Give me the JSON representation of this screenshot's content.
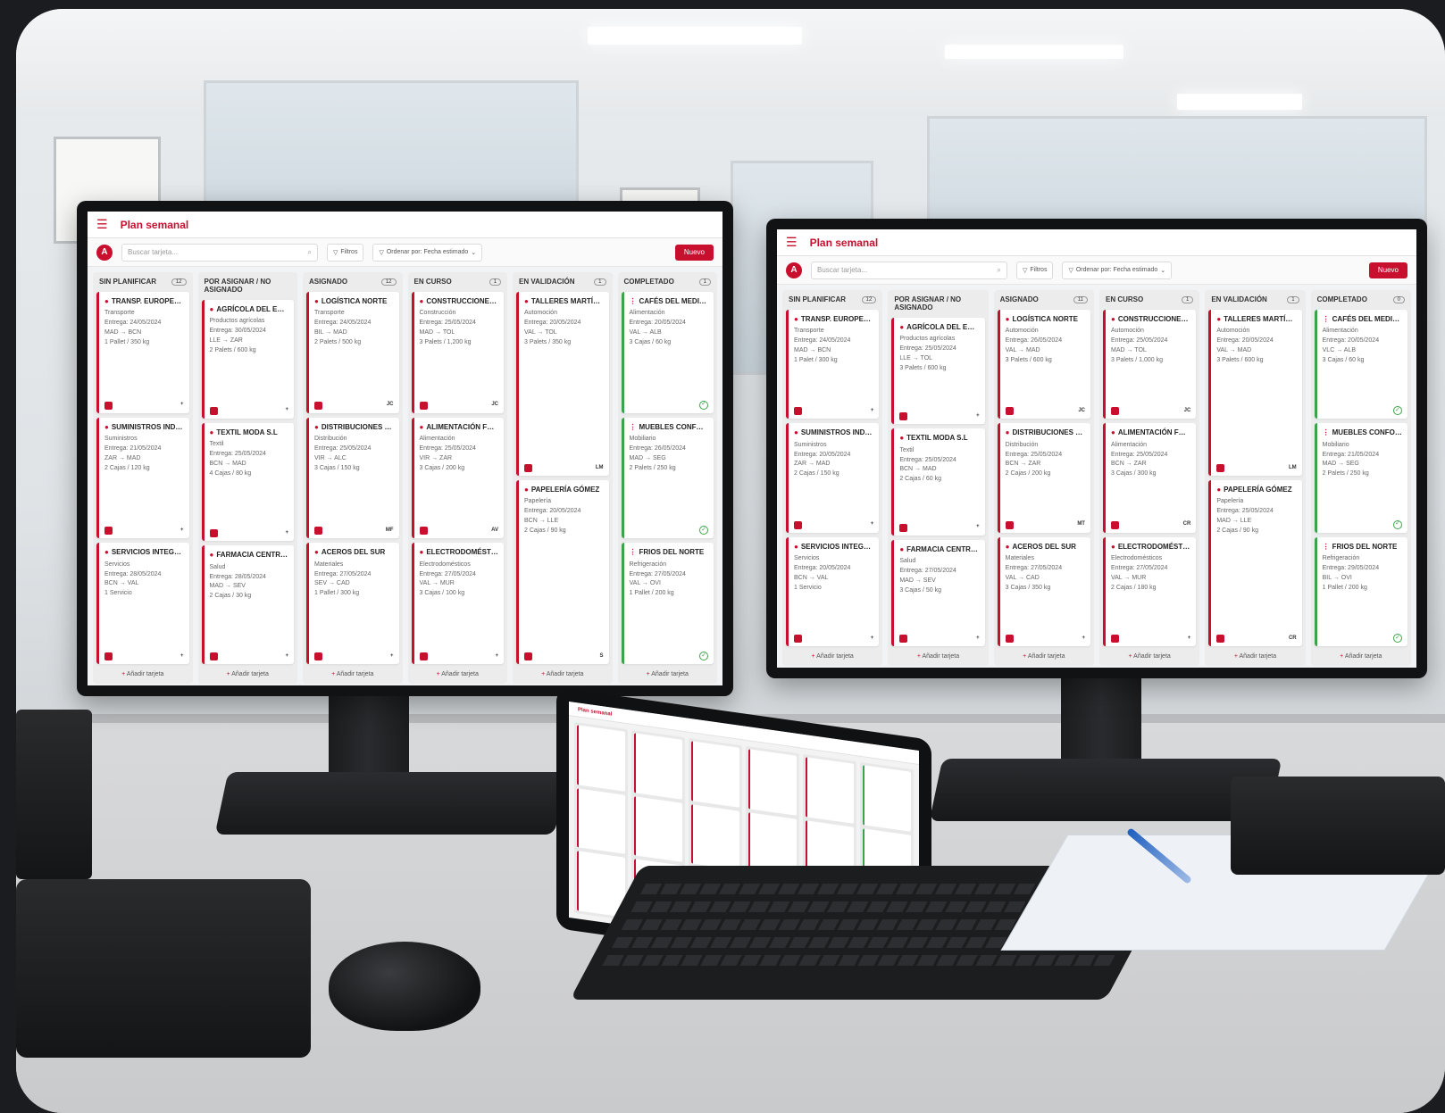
{
  "app": {
    "title": "Plan semanal",
    "logo_letter": "A",
    "search_placeholder": "Buscar tarjeta...",
    "filters_label": "Filtros",
    "sort_label": "Ordenar por: Fecha estimado",
    "new_button": "Nuevo",
    "add_card": "Añadir tarjeta"
  },
  "accent_color": "#c8102e",
  "done_color": "#3da34a",
  "left_board": {
    "columns": [
      {
        "title": "SIN PLANIFICAR",
        "count": "12",
        "cards": [
          {
            "name": "TRANSP. EUROPEO S.L.",
            "cat": "Transporte",
            "date": "Entrega: 24/05/2024",
            "route": "MAD → BCN",
            "load": "1 Pallet / 350 kg",
            "ini": ""
          },
          {
            "name": "SUMINISTROS INDUSTRIALES",
            "cat": "Suministros",
            "date": "Entrega: 21/05/2024",
            "route": "ZAR → MAD",
            "load": "2 Cajas / 120 kg",
            "ini": ""
          },
          {
            "name": "SERVICIOS INTEGRALES",
            "cat": "Servicios",
            "date": "Entrega: 28/05/2024",
            "route": "BCN → VAL",
            "load": "1 Servicio",
            "ini": ""
          }
        ]
      },
      {
        "title": "POR ASIGNAR / NO ASIGNADO",
        "count": "",
        "cards": [
          {
            "name": "AGRÍCOLA DEL EBRO",
            "cat": "Productos agrícolas",
            "date": "Entrega: 30/05/2024",
            "route": "LLE → ZAR",
            "load": "2 Palets / 600 kg",
            "ini": ""
          },
          {
            "name": "TEXTIL MODA S.L",
            "cat": "Textil",
            "date": "Entrega: 25/05/2024",
            "route": "BCN → MAD",
            "load": "4 Cajas / 80 kg",
            "ini": ""
          },
          {
            "name": "FARMACIA CENTRAL",
            "cat": "Salud",
            "date": "Entrega: 28/05/2024",
            "route": "MAD → SEV",
            "load": "2 Cajas / 30 kg",
            "ini": ""
          }
        ]
      },
      {
        "title": "ASIGNADO",
        "count": "12",
        "cards": [
          {
            "name": "LOGÍSTICA NORTE",
            "cat": "Transporte",
            "date": "Entrega: 24/05/2024",
            "route": "BIL → MAD",
            "load": "2 Palets / 500 kg",
            "ini": "JC"
          },
          {
            "name": "DISTRIBUCIONES LEVANTE",
            "cat": "Distribución",
            "date": "Entrega: 25/05/2024",
            "route": "VIR → ALC",
            "load": "3 Cajas / 150 kg",
            "ini": "MF"
          },
          {
            "name": "ACEROS DEL SUR",
            "cat": "Materiales",
            "date": "Entrega: 27/05/2024",
            "route": "SEV → CAD",
            "load": "1 Pallet / 300 kg",
            "ini": ""
          }
        ]
      },
      {
        "title": "EN CURSO",
        "count": "1",
        "cards": [
          {
            "name": "CONSTRUCCIONES & CÍA",
            "cat": "Construcción",
            "date": "Entrega: 25/05/2024",
            "route": "MAD → TOL",
            "load": "3 Palets / 1,200 kg",
            "ini": "JC"
          },
          {
            "name": "ALIMENTACIÓN FRESCA",
            "cat": "Alimentación",
            "date": "Entrega: 25/05/2024",
            "route": "VIR → ZAR",
            "load": "3 Cajas / 200 kg",
            "ini": "AV"
          },
          {
            "name": "ELECTRODOMÉSTICOS DELUXE",
            "cat": "Electrodomésticos",
            "date": "Entrega: 27/05/2024",
            "route": "VAL → MUR",
            "load": "3 Cajas / 100 kg",
            "ini": ""
          }
        ]
      },
      {
        "title": "EN VALIDACIÓN",
        "count": "1",
        "cards": [
          {
            "name": "TALLERES MARTÍNEZ",
            "cat": "Automoción",
            "date": "Entrega: 20/05/2024",
            "route": "VAL → TOL",
            "load": "3 Palets / 350 kg",
            "ini": "LM"
          },
          {
            "name": "PAPELERÍA GÓMEZ",
            "cat": "Papelería",
            "date": "Entrega: 20/05/2024",
            "route": "BCN → LLE",
            "load": "2 Cajas / 90 kg",
            "ini": "S"
          }
        ]
      },
      {
        "title": "COMPLETADO",
        "count": "1",
        "done": true,
        "cards": [
          {
            "name": "CAFÉS DEL MEDITERRÁNEO",
            "cat": "Alimentación",
            "date": "Entrega: 20/05/2024",
            "route": "VAL → ALB",
            "load": "3 Cajas / 60 kg",
            "ini": ""
          },
          {
            "name": "MUEBLES CONFORT",
            "cat": "Mobiliario",
            "date": "Entrega: 26/05/2024",
            "route": "MAD → SEG",
            "load": "2 Palets / 250 kg",
            "ini": ""
          },
          {
            "name": "FRIOS DEL NORTE",
            "cat": "Refrigeración",
            "date": "Entrega: 27/05/2024",
            "route": "VAL → OVI",
            "load": "1 Pallet / 200 kg",
            "ini": ""
          }
        ]
      }
    ]
  },
  "right_board": {
    "columns": [
      {
        "title": "SIN PLANIFICAR",
        "count": "12",
        "cards": [
          {
            "name": "TRANSP. EUROPEO S.L.",
            "cat": "Transporte",
            "date": "Entrega: 24/05/2024",
            "route": "MAD → BCN",
            "load": "1 Palet / 300 kg",
            "ini": ""
          },
          {
            "name": "SUMINISTROS INDUSTRIALES",
            "cat": "Suministros",
            "date": "Entrega: 20/05/2024",
            "route": "ZAR → MAD",
            "load": "2 Cajas / 150 kg",
            "ini": ""
          },
          {
            "name": "SERVICIOS INTEGRALES",
            "cat": "Servicios",
            "date": "Entrega: 20/05/2024",
            "route": "BCN → VAL",
            "load": "1 Servicio",
            "ini": ""
          }
        ]
      },
      {
        "title": "POR ASIGNAR / NO ASIGNADO",
        "count": "",
        "cards": [
          {
            "name": "AGRÍCOLA DEL EBRO",
            "cat": "Productos agrícolas",
            "date": "Entrega: 25/05/2024",
            "route": "LLE → TOL",
            "load": "3 Palets / 600 kg",
            "ini": ""
          },
          {
            "name": "TEXTIL MODA S.L",
            "cat": "Textil",
            "date": "Entrega: 25/05/2024",
            "route": "BCN → MAD",
            "load": "2 Cajas / 60 kg",
            "ini": ""
          },
          {
            "name": "FARMACIA CENTRAL",
            "cat": "Salud",
            "date": "Entrega: 27/05/2024",
            "route": "MAD → SEV",
            "load": "3 Cajas / 50 kg",
            "ini": ""
          }
        ]
      },
      {
        "title": "ASIGNADO",
        "count": "11",
        "cards": [
          {
            "name": "LOGÍSTICA NORTE",
            "cat": "Automoción",
            "date": "Entrega: 26/05/2024",
            "route": "VAL → MAD",
            "load": "3 Palets / 600 kg",
            "ini": "JC"
          },
          {
            "name": "DISTRIBUCIONES LEVANTE",
            "cat": "Distribución",
            "date": "Entrega: 25/05/2024",
            "route": "BCN → ZAR",
            "load": "2 Cajas / 200 kg",
            "ini": "MT"
          },
          {
            "name": "ACEROS DEL SUR",
            "cat": "Materiales",
            "date": "Entrega: 27/05/2024",
            "route": "VAL → CAD",
            "load": "3 Cajas / 350 kg",
            "ini": ""
          }
        ]
      },
      {
        "title": "EN CURSO",
        "count": "1",
        "cards": [
          {
            "name": "CONSTRUCCIONES & CÍA",
            "cat": "Automoción",
            "date": "Entrega: 25/05/2024",
            "route": "MAD → TOL",
            "load": "3 Palets / 1,000 kg",
            "ini": "JC"
          },
          {
            "name": "ALIMENTACIÓN FRESCA",
            "cat": "Alimentación",
            "date": "Entrega: 25/05/2024",
            "route": "BCN → ZAR",
            "load": "3 Cajas / 300 kg",
            "ini": "CR"
          },
          {
            "name": "ELECTRODOMÉSTICOS DELUXE",
            "cat": "Electrodomésticos",
            "date": "Entrega: 27/05/2024",
            "route": "VAL → MUR",
            "load": "2 Cajas / 180 kg",
            "ini": ""
          }
        ]
      },
      {
        "title": "EN VALIDACIÓN",
        "count": "1",
        "cards": [
          {
            "name": "TALLERES MARTÍNEZ",
            "cat": "Automoción",
            "date": "Entrega: 20/05/2024",
            "route": "VAL → MAD",
            "load": "3 Palets / 600 kg",
            "ini": "LM"
          },
          {
            "name": "PAPELERÍA GÓMEZ",
            "cat": "Papelería",
            "date": "Entrega: 25/05/2024",
            "route": "MAD → LLE",
            "load": "2 Cajas / 90 kg",
            "ini": "CR"
          }
        ]
      },
      {
        "title": "COMPLETADO",
        "count": "0",
        "done": true,
        "cards": [
          {
            "name": "CAFÉS DEL MEDITERRÁNEO",
            "cat": "Alimentación",
            "date": "Entrega: 20/05/2024",
            "route": "VLC → ALB",
            "load": "3 Cajas / 60 kg",
            "ini": ""
          },
          {
            "name": "MUEBLES CONFORT",
            "cat": "Mobiliario",
            "date": "Entrega: 21/05/2024",
            "route": "MAD → SEG",
            "load": "2 Palets / 250 kg",
            "ini": ""
          },
          {
            "name": "FRIOS DEL NORTE",
            "cat": "Refrigeración",
            "date": "Entrega: 29/05/2024",
            "route": "BIL → OVI",
            "load": "1 Pallet / 200 kg",
            "ini": ""
          }
        ]
      }
    ]
  },
  "tablet": {
    "title": "Plan semanal"
  }
}
